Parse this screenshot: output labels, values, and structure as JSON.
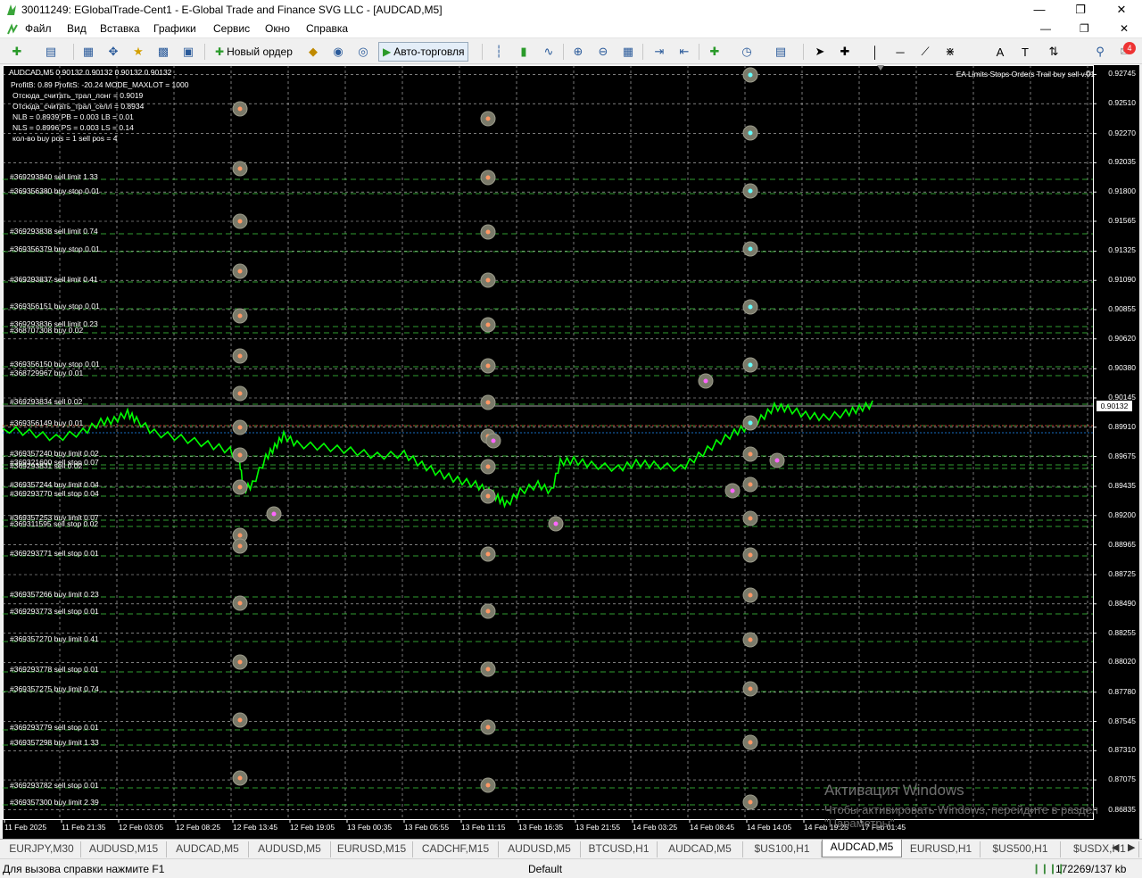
{
  "window": {
    "title": "30011249: EGlobalTrade-Cent1 - E-Global Trade and Finance SVG LLC - [AUDCAD,M5]"
  },
  "menu": [
    "Файл",
    "Вид",
    "Вставка",
    "Графики",
    "Сервис",
    "Окно",
    "Справка"
  ],
  "toolbar": {
    "new_order": "Новый ордер",
    "autotrading": "Авто-торговля",
    "notify_count": "4"
  },
  "chart": {
    "symbol": "AUDCAD",
    "timeframe": "M5",
    "header_line": "AUDCAD,M5  0.90132 0.90132 0.90132 0.90132",
    "ea_name": "EA Limits Stops Orders Trail buy sell v.01",
    "current_price": "0.90132",
    "info_lines": [
      "ProfitB: 0.89  ProfitS: -20.24  MODE_MAXLOT = 1000",
      "Отсюда_считать_трал_лонг = 0.9019",
      "Отсюда_считать_трал_селл = 0.8934",
      "NLB = 0.8939  PB = 0.003  LB = 0.01",
      "NLS = 0.8996  PS = 0.003  LS = 0.14",
      "кол-во buy pos = 1  sell pos = 4"
    ],
    "price_axis": [
      "0.92745",
      "0.92510",
      "0.92270",
      "0.92035",
      "0.91800",
      "0.91565",
      "0.91325",
      "0.91090",
      "0.90855",
      "0.90620",
      "0.90380",
      "0.90145",
      "0.89910",
      "0.89675",
      "0.89435",
      "0.89200",
      "0.88965",
      "0.88725",
      "0.88490",
      "0.88255",
      "0.88020",
      "0.87780",
      "0.87545",
      "0.87310",
      "0.87075",
      "0.86835"
    ],
    "time_axis": [
      "11 Feb 2025",
      "11 Feb 21:35",
      "12 Feb 03:05",
      "12 Feb 08:25",
      "12 Feb 13:45",
      "12 Feb 19:05",
      "13 Feb 00:35",
      "13 Feb 05:55",
      "13 Feb 11:15",
      "13 Feb 16:35",
      "13 Feb 21:55",
      "14 Feb 03:25",
      "14 Feb 08:45",
      "14 Feb 14:05",
      "14 Feb 19:25",
      "17 Feb 01:45"
    ],
    "order_labels": [
      "#369293840 sell limit 1.33",
      "#369356380 buy stop 0.01",
      "#369293838 sell limit 0.74",
      "#369356379 buy stop 0.01",
      "#369293837 sell limit 0.41",
      "#369356151 buy stop 0.01",
      "#369293836 sell limit 0.23",
      "#368707308 buy 0.02",
      "#369356150 buy stop 0.01",
      "#368729967 buy 0.01",
      "#369293834 sell 0.02",
      "#369356149 buy 0.01",
      "#369357240 buy limit 0.02",
      "#369321600 sell stop 0.07",
      "#369293831 sell 0.02",
      "#369357244 buy limit 0.04",
      "#369293770 sell stop 0.04",
      "#369357253 buy limit 0.07",
      "#369311595 sell stop 0.02",
      "#369293771 sell stop 0.01",
      "#369357266 buy limit 0.23",
      "#369293773 sell stop 0.01",
      "#369357270 buy limit 0.41",
      "#369293778 sell stop 0.01",
      "#369357275 buy limit 0.74",
      "#369293779 sell stop 0.01",
      "#369357298 buy limit 1.33",
      "#369293782 sell stop 0.01",
      "#369357300 buy limit 2.39"
    ],
    "watermark_title": "Активация Windows",
    "watermark_text": "Чтобы активировать Windows, перейдите в раздел \"Параметры\"."
  },
  "tabs": [
    {
      "label": "EURJPY,M30"
    },
    {
      "label": "AUDUSD,M15"
    },
    {
      "label": "AUDCAD,M5"
    },
    {
      "label": "AUDUSD,M5"
    },
    {
      "label": "EURUSD,M15"
    },
    {
      "label": "CADCHF,M15"
    },
    {
      "label": "AUDUSD,M5"
    },
    {
      "label": "BTCUSD,H1"
    },
    {
      "label": "AUDCAD,M5"
    },
    {
      "label": "$US100,H1"
    },
    {
      "label": "AUDCAD,M5"
    },
    {
      "label": "EURUSD,H1"
    },
    {
      "label": "$US500,H1"
    },
    {
      "label": "$USDX,H1"
    }
  ],
  "active_tab": 10,
  "status": {
    "help": "Для вызова справки нажмите F1",
    "profile": "Default",
    "traffic": "172269/137 kb"
  },
  "colors": {
    "candles": "#00ff00",
    "grid": "#c8c8c8",
    "buy_line": "#1e90ff",
    "sell_line": "#ff4040",
    "level_line": "#3fd13f"
  }
}
